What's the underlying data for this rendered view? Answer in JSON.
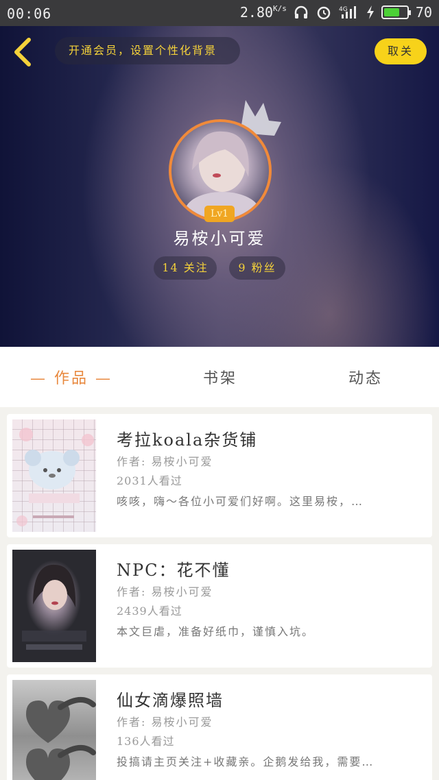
{
  "status_bar": {
    "time": "00:06",
    "speed": "2.80",
    "speed_unit": "K/s",
    "battery_level": "70",
    "battery_fraction": 0.7,
    "icons": [
      "headphones-icon",
      "alarm-icon",
      "signal-4g-icon",
      "charging-icon",
      "battery-icon"
    ]
  },
  "header": {
    "vip_banner": "开通会员，设置个性化背景",
    "close_label": "取关",
    "level": "Lv1",
    "username": "易桉小可爱",
    "follow": "14 关注",
    "fans": "9 粉丝",
    "colors": {
      "accent": "#f7d21a",
      "avatar_ring": "#f08a3a",
      "level_badge": "#f0a622"
    }
  },
  "tabs": [
    {
      "label": "— 作品 —",
      "active": true
    },
    {
      "label": "书架",
      "active": false
    },
    {
      "label": "动态",
      "active": false
    }
  ],
  "works": [
    {
      "title": "考拉koala杂货铺",
      "author": "作者: 易桉小可爱",
      "views": "2031人看过",
      "description": "咳咳，嗨～各位小可爱们好啊。这里易桉，…"
    },
    {
      "title": "NPC：花不懂",
      "author": "作者: 易桉小可爱",
      "views": "2439人看过",
      "description": "本文巨虐，准备好纸巾，谨慎入坑。"
    },
    {
      "title": "仙女滴爆照墙",
      "author": "作者: 易桉小可爱",
      "views": "136人看过",
      "description": "投搞请主页关注+收藏亲。企鹅发给我，需要…"
    }
  ]
}
